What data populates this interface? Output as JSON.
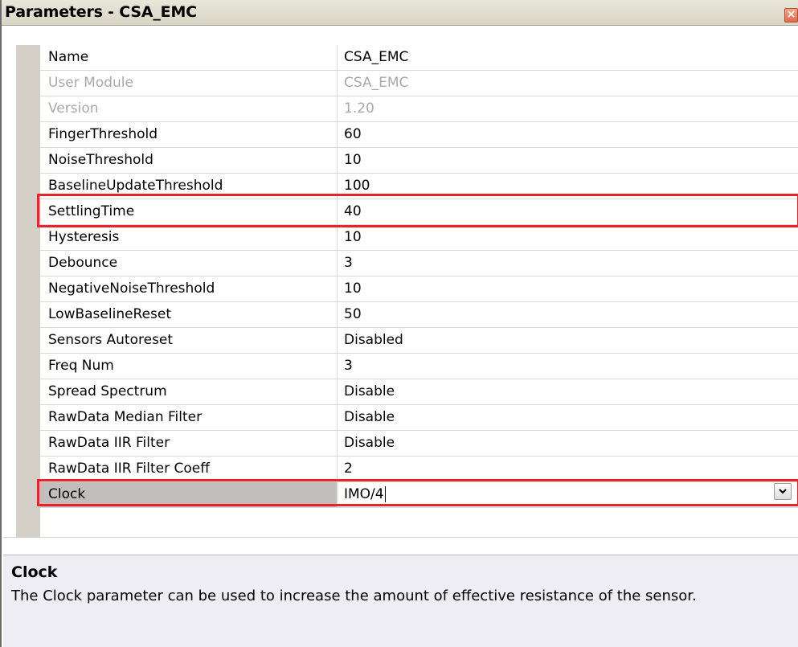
{
  "window": {
    "title": "Parameters - CSA_EMC",
    "close_label": "×"
  },
  "parameters": [
    {
      "name": "Name",
      "value": "CSA_EMC",
      "disabled": false
    },
    {
      "name": "User Module",
      "value": "CSA_EMC",
      "disabled": true
    },
    {
      "name": "Version",
      "value": "1.20",
      "disabled": true
    },
    {
      "name": "FingerThreshold",
      "value": "60",
      "disabled": false
    },
    {
      "name": "NoiseThreshold",
      "value": "10",
      "disabled": false
    },
    {
      "name": "BaselineUpdateThreshold",
      "value": "100",
      "disabled": false
    },
    {
      "name": "SettlingTime",
      "value": "40",
      "disabled": false
    },
    {
      "name": "Hysteresis",
      "value": "10",
      "disabled": false
    },
    {
      "name": "Debounce",
      "value": "3",
      "disabled": false
    },
    {
      "name": "NegativeNoiseThreshold",
      "value": "10",
      "disabled": false
    },
    {
      "name": "LowBaselineReset",
      "value": "50",
      "disabled": false
    },
    {
      "name": "Sensors Autoreset",
      "value": "Disabled",
      "disabled": false
    },
    {
      "name": "Freq Num",
      "value": "3",
      "disabled": false
    },
    {
      "name": "Spread Spectrum",
      "value": "Disable",
      "disabled": false
    },
    {
      "name": "RawData Median Filter",
      "value": "Disable",
      "disabled": false
    },
    {
      "name": "RawData IIR Filter",
      "value": "Disable",
      "disabled": false
    },
    {
      "name": "RawData IIR Filter Coeff",
      "value": "2",
      "disabled": false
    },
    {
      "name": "Clock",
      "value": "IMO/4",
      "disabled": false,
      "selected": true
    }
  ],
  "description": {
    "title": "Clock",
    "text": "The Clock parameter can be used to increase the amount of effective resistance of the sensor."
  },
  "colors": {
    "highlight": "#e8232a",
    "selected_row": "#c0bfbb",
    "disabled_text": "#a9a9a9"
  }
}
